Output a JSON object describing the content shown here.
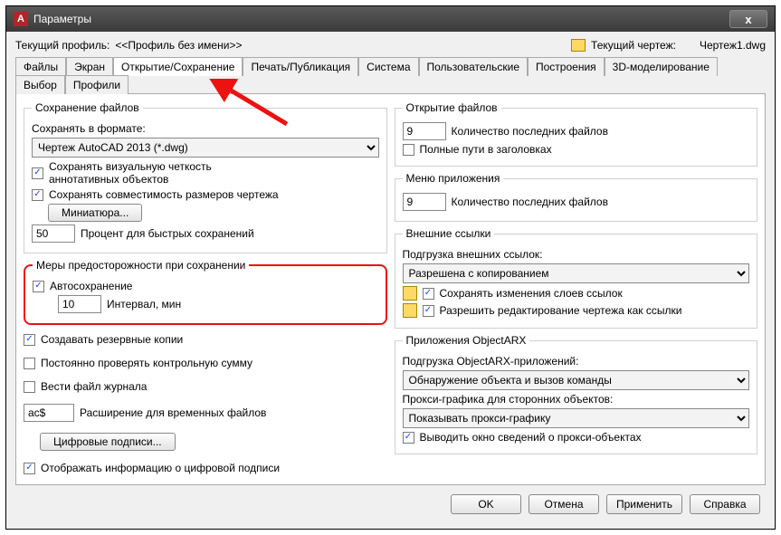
{
  "window": {
    "title": "Параметры"
  },
  "profile": {
    "label": "Текущий профиль:",
    "value": "<<Профиль без имени>>",
    "drawing_label": "Текущий чертеж:",
    "drawing_value": "Чертеж1.dwg"
  },
  "tabs": [
    "Файлы",
    "Экран",
    "Открытие/Сохранение",
    "Печать/Публикация",
    "Система",
    "Пользовательские",
    "Построения",
    "3D-моделирование",
    "Выбор",
    "Профили"
  ],
  "active_tab": 2,
  "save_files": {
    "legend": "Сохранение файлов",
    "save_as_label": "Сохранять в формате:",
    "format": "Чертеж AutoCAD 2013 (*.dwg)",
    "keep_visual": "Сохранять визуальную четкость аннотативных объектов",
    "keep_compat": "Сохранять совместимость размеров чертежа",
    "miniature": "Миниатюра...",
    "percent": "50",
    "percent_label": "Процент для быстрых сохранений"
  },
  "precautions": {
    "legend": "Меры предосторожности при сохранении",
    "autosave": "Автосохранение",
    "interval": "10",
    "interval_label": "Интервал, мин"
  },
  "extra": {
    "backup": "Создавать резервные копии",
    "checksum": "Постоянно проверять контрольную сумму",
    "log": "Вести файл журнала",
    "ext": "ac$",
    "ext_label": "Расширение для временных файлов",
    "sigs": "Цифровые подписи...",
    "show_sig": "Отображать информацию о цифровой подписи"
  },
  "open": {
    "legend": "Открытие файлов",
    "recent": "9",
    "recent_label": "Количество последних файлов",
    "fullpath": "Полные пути в заголовках"
  },
  "appmenu": {
    "legend": "Меню приложения",
    "recent": "9",
    "recent_label": "Количество последних файлов"
  },
  "xrefs": {
    "legend": "Внешние ссылки",
    "load_label": "Подгрузка внешних ссылок:",
    "load_value": "Разрешена с копированием",
    "save_layers": "Сохранять изменения слоев ссылок",
    "allow_edit": "Разрешить редактирование чертежа как ссылки"
  },
  "arx": {
    "legend": "Приложения ObjectARX",
    "load_label": "Подгрузка ObjectARX-приложений:",
    "load_value": "Обнаружение объекта и вызов команды",
    "proxy_label": "Прокси-графика для сторонних объектов:",
    "proxy_value": "Показывать прокси-графику",
    "show_proxy": "Выводить окно сведений о прокси-объектах"
  },
  "footer": {
    "ok": "OK",
    "cancel": "Отмена",
    "apply": "Применить",
    "help": "Справка"
  }
}
